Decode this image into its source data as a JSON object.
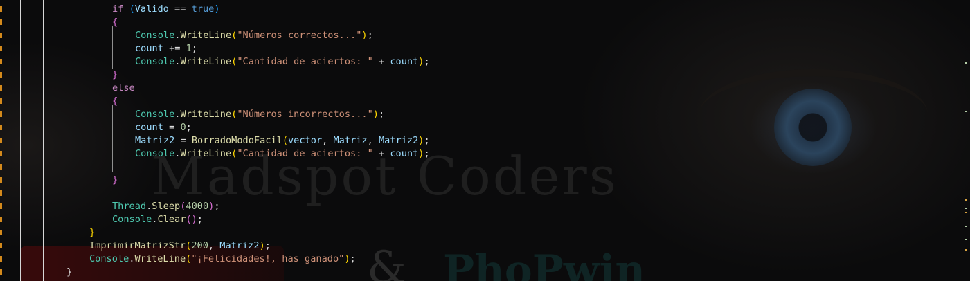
{
  "code": {
    "lines": [
      {
        "indent": 4,
        "tokens": [
          {
            "t": "if",
            "c": "kw"
          },
          {
            "t": " ",
            "c": "pl"
          },
          {
            "t": "(",
            "c": "br-b"
          },
          {
            "t": "Valido",
            "c": "var"
          },
          {
            "t": " == ",
            "c": "pl"
          },
          {
            "t": "true",
            "c": "kwb"
          },
          {
            "t": ")",
            "c": "br-b"
          }
        ]
      },
      {
        "indent": 4,
        "tokens": [
          {
            "t": "{",
            "c": "br-m"
          }
        ]
      },
      {
        "indent": 5,
        "tokens": [
          {
            "t": "Console",
            "c": "cls"
          },
          {
            "t": ".",
            "c": "pl"
          },
          {
            "t": "WriteLine",
            "c": "mth"
          },
          {
            "t": "(",
            "c": "br-y"
          },
          {
            "t": "\"Números correctos...\"",
            "c": "str"
          },
          {
            "t": ")",
            "c": "br-y"
          },
          {
            "t": ";",
            "c": "pl"
          }
        ]
      },
      {
        "indent": 5,
        "tokens": [
          {
            "t": "count",
            "c": "var"
          },
          {
            "t": " += ",
            "c": "pl"
          },
          {
            "t": "1",
            "c": "num"
          },
          {
            "t": ";",
            "c": "pl"
          }
        ]
      },
      {
        "indent": 5,
        "tokens": [
          {
            "t": "Console",
            "c": "cls"
          },
          {
            "t": ".",
            "c": "pl"
          },
          {
            "t": "WriteLine",
            "c": "mth"
          },
          {
            "t": "(",
            "c": "br-y"
          },
          {
            "t": "\"Cantidad de aciertos: \"",
            "c": "str"
          },
          {
            "t": " + ",
            "c": "pl"
          },
          {
            "t": "count",
            "c": "var"
          },
          {
            "t": ")",
            "c": "br-y"
          },
          {
            "t": ";",
            "c": "pl"
          }
        ]
      },
      {
        "indent": 4,
        "tokens": [
          {
            "t": "}",
            "c": "br-m"
          }
        ]
      },
      {
        "indent": 4,
        "tokens": [
          {
            "t": "else",
            "c": "kw"
          }
        ]
      },
      {
        "indent": 4,
        "tokens": [
          {
            "t": "{",
            "c": "br-m"
          }
        ]
      },
      {
        "indent": 5,
        "tokens": [
          {
            "t": "Console",
            "c": "cls"
          },
          {
            "t": ".",
            "c": "pl"
          },
          {
            "t": "WriteLine",
            "c": "mth"
          },
          {
            "t": "(",
            "c": "br-y"
          },
          {
            "t": "\"Números incorrectos...\"",
            "c": "str"
          },
          {
            "t": ")",
            "c": "br-y"
          },
          {
            "t": ";",
            "c": "pl"
          }
        ]
      },
      {
        "indent": 5,
        "tokens": [
          {
            "t": "count",
            "c": "var"
          },
          {
            "t": " = ",
            "c": "pl"
          },
          {
            "t": "0",
            "c": "num"
          },
          {
            "t": ";",
            "c": "pl"
          }
        ]
      },
      {
        "indent": 5,
        "tokens": [
          {
            "t": "Matriz2",
            "c": "var"
          },
          {
            "t": " = ",
            "c": "pl"
          },
          {
            "t": "BorradoModoFacil",
            "c": "mth"
          },
          {
            "t": "(",
            "c": "br-y"
          },
          {
            "t": "vector",
            "c": "var"
          },
          {
            "t": ", ",
            "c": "pl"
          },
          {
            "t": "Matriz",
            "c": "var"
          },
          {
            "t": ", ",
            "c": "pl"
          },
          {
            "t": "Matriz2",
            "c": "var"
          },
          {
            "t": ")",
            "c": "br-y"
          },
          {
            "t": ";",
            "c": "pl"
          }
        ]
      },
      {
        "indent": 5,
        "tokens": [
          {
            "t": "Console",
            "c": "cls"
          },
          {
            "t": ".",
            "c": "pl"
          },
          {
            "t": "WriteLine",
            "c": "mth"
          },
          {
            "t": "(",
            "c": "br-y"
          },
          {
            "t": "\"Cantidad de aciertos: \"",
            "c": "str"
          },
          {
            "t": " + ",
            "c": "pl"
          },
          {
            "t": "count",
            "c": "var"
          },
          {
            "t": ")",
            "c": "br-y"
          },
          {
            "t": ";",
            "c": "pl"
          }
        ]
      },
      {
        "indent": 0,
        "tokens": []
      },
      {
        "indent": 4,
        "tokens": [
          {
            "t": "}",
            "c": "br-m"
          }
        ]
      },
      {
        "indent": 0,
        "tokens": []
      },
      {
        "indent": 4,
        "tokens": [
          {
            "t": "Thread",
            "c": "cls"
          },
          {
            "t": ".",
            "c": "pl"
          },
          {
            "t": "Sleep",
            "c": "mth"
          },
          {
            "t": "(",
            "c": "br-m"
          },
          {
            "t": "4000",
            "c": "num"
          },
          {
            "t": ")",
            "c": "br-m"
          },
          {
            "t": ";",
            "c": "pl"
          }
        ]
      },
      {
        "indent": 4,
        "tokens": [
          {
            "t": "Console",
            "c": "cls"
          },
          {
            "t": ".",
            "c": "pl"
          },
          {
            "t": "Clear",
            "c": "mth"
          },
          {
            "t": "()",
            "c": "br-m"
          },
          {
            "t": ";",
            "c": "pl"
          }
        ]
      },
      {
        "indent": 3,
        "tokens": [
          {
            "t": "}",
            "c": "br-y"
          }
        ]
      },
      {
        "indent": 3,
        "tokens": [
          {
            "t": "ImprimirMatrizStr",
            "c": "mth"
          },
          {
            "t": "(",
            "c": "br-y"
          },
          {
            "t": "200",
            "c": "num"
          },
          {
            "t": ", ",
            "c": "pl"
          },
          {
            "t": "Matriz2",
            "c": "var"
          },
          {
            "t": ")",
            "c": "br-y"
          },
          {
            "t": ";",
            "c": "pl"
          }
        ]
      },
      {
        "indent": 3,
        "tokens": [
          {
            "t": "Console",
            "c": "cls"
          },
          {
            "t": ".",
            "c": "pl"
          },
          {
            "t": "WriteLine",
            "c": "mth"
          },
          {
            "t": "(",
            "c": "br-y"
          },
          {
            "t": "\"¡Felicidades!, has ganado\"",
            "c": "str"
          },
          {
            "t": ")",
            "c": "br-y"
          },
          {
            "t": ";",
            "c": "pl"
          }
        ]
      },
      {
        "indent": 2,
        "tokens": [
          {
            "t": "}",
            "c": "pl"
          }
        ]
      }
    ]
  },
  "watermark": {
    "text": "Madspot Coders",
    "text2": "PhoPwin",
    "amp": "&"
  },
  "colors": {
    "keyword": "#c586c0",
    "class": "#4ec9b0",
    "method": "#dcdcaa",
    "string": "#ce9178",
    "number": "#b5cea8",
    "variable": "#9cdcfe",
    "gutter_mark": "#d48a1c"
  }
}
